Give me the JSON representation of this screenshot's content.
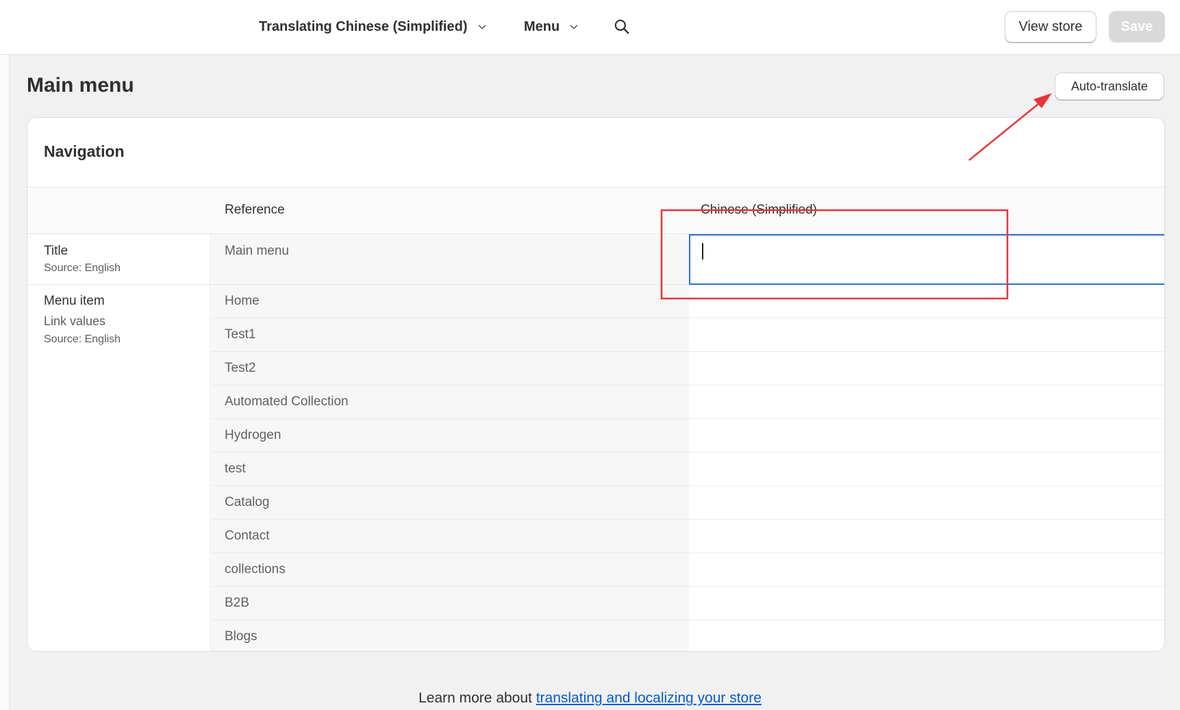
{
  "topbar": {
    "language_dropdown": "Translating Chinese (Simplified)",
    "resource_dropdown": "Menu",
    "view_store_label": "View store",
    "save_label": "Save"
  },
  "page": {
    "title": "Main menu",
    "auto_translate_label": "Auto-translate"
  },
  "card": {
    "title": "Navigation",
    "columns": {
      "reference": "Reference",
      "target": "Chinese (Simplified)"
    },
    "title_field": {
      "label": "Title",
      "source": "Source: English",
      "reference_value": "Main menu",
      "translation_value": ""
    },
    "menu_item": {
      "label": "Menu item",
      "sublabel": "Link values",
      "source": "Source: English",
      "items": [
        "Home",
        "Test1",
        "Test2",
        "Automated Collection",
        "Hydrogen",
        "test",
        "Catalog",
        "Contact",
        "collections",
        "B2B",
        "Blogs"
      ]
    }
  },
  "footer": {
    "prefix": "Learn more about ",
    "link": "translating and localizing your store"
  },
  "colors": {
    "accent_blue": "#2c6ecb",
    "link_blue": "#005bd3",
    "annotation_red": "#e8353a"
  }
}
